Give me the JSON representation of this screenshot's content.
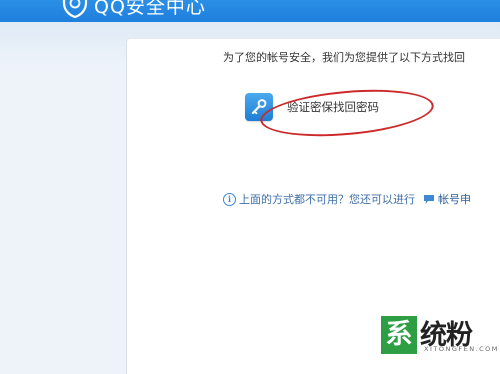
{
  "header": {
    "brand": "QQ安全中心",
    "logo_icon": "shield-icon",
    "background": "#1f7fdc"
  },
  "recovery": {
    "intro": "为了您的帐号安全，我们为您提供了以下方式找回",
    "option_label": "验证密保找回密码",
    "option_icon": "key-icon",
    "annotation_color": "#cc2a2a",
    "alt_text": "上面的方式都不可用？您还可以进行",
    "alt_icon": "info-icon",
    "appeal_icon": "chat-bubble-icon",
    "appeal_link": "帐号申"
  },
  "watermark": {
    "badge": "系",
    "text": "统粉",
    "subtext": "XITONGFEN.COM"
  }
}
